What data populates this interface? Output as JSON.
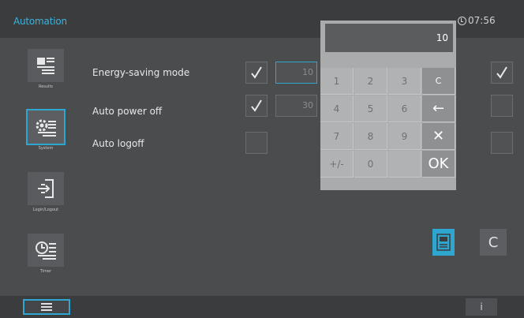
{
  "header": {
    "title": "Automation",
    "time": "07:56"
  },
  "sidebar": {
    "items": [
      {
        "label": "Results",
        "icon": "results-icon"
      },
      {
        "label": "System",
        "icon": "system-gear-icon",
        "active": true
      },
      {
        "label": "Login/Logout",
        "icon": "login-logout-icon"
      },
      {
        "label": "Timer",
        "icon": "timer-clock-icon"
      }
    ]
  },
  "settings": {
    "rows": [
      {
        "label": "Energy-saving mode",
        "checked": true,
        "value": "10"
      },
      {
        "label": "Auto power off",
        "checked": true,
        "value": "30"
      },
      {
        "label": "Auto logoff",
        "checked": false,
        "value": ""
      }
    ]
  },
  "keypad": {
    "display": "10",
    "keys": [
      "1",
      "2",
      "3",
      "C",
      "4",
      "5",
      "6",
      "←",
      "7",
      "8",
      "9",
      "✕",
      "+/-",
      "0",
      "",
      "OK"
    ]
  },
  "actions": {
    "clear_label": "C"
  },
  "footer": {
    "info_label": "i"
  },
  "colors": {
    "accent": "#2ea6cf",
    "background": "#4a4c4e"
  }
}
